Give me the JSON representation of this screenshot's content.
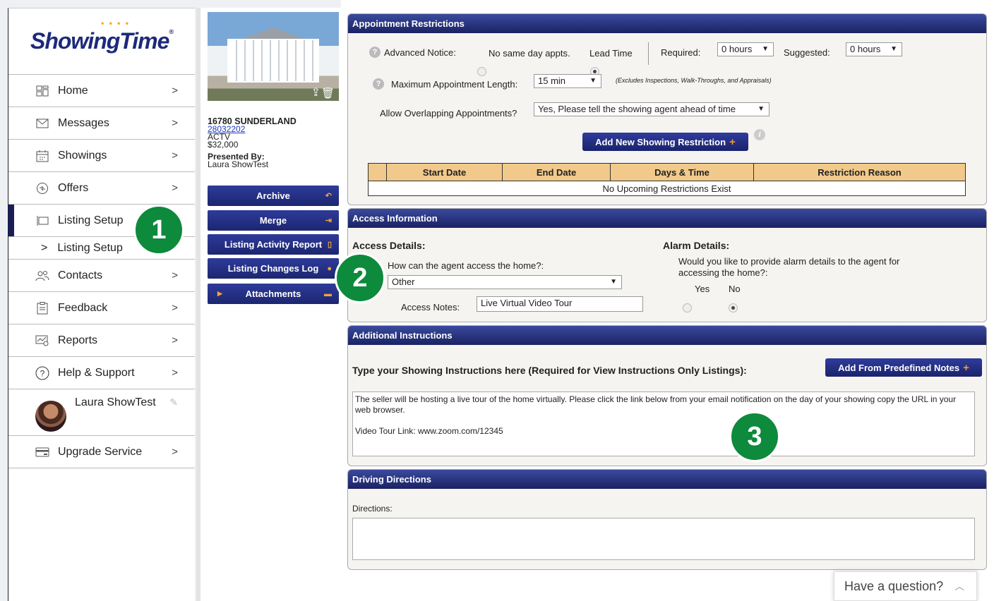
{
  "sidebar": {
    "logo": "ShowingTime",
    "items": [
      {
        "label": "Home",
        "icon": "home-grid-icon",
        "arrow": ">"
      },
      {
        "label": "Messages",
        "icon": "envelope-icon",
        "arrow": ">"
      },
      {
        "label": "Showings",
        "icon": "calendar-icon",
        "arrow": ">"
      },
      {
        "label": "Offers",
        "icon": "offer-icon",
        "arrow": ">"
      },
      {
        "label": "Listing Setup",
        "icon": "flag-icon",
        "arrow": ""
      },
      {
        "label": "Contacts",
        "icon": "contacts-icon",
        "arrow": ">"
      },
      {
        "label": "Feedback",
        "icon": "clipboard-icon",
        "arrow": ">"
      },
      {
        "label": "Reports",
        "icon": "reports-icon",
        "arrow": ">"
      },
      {
        "label": "Help & Support",
        "icon": "help-circle-icon",
        "arrow": ">"
      }
    ],
    "sub_item": {
      "prefix": ">",
      "label": "Listing Setup"
    },
    "user": {
      "name": "Laura ShowTest"
    },
    "upgrade": {
      "label": "Upgrade Service",
      "arrow": ">"
    }
  },
  "listing": {
    "address": "16780 SUNDERLAND",
    "mls": "28032202",
    "status": "ACTV",
    "price": "$32,000",
    "presented_by_label": "Presented By:",
    "presented_by": "Laura ShowTest",
    "buttons": [
      "Archive",
      "Merge",
      "Listing Activity Report",
      "Listing Changes Log",
      "Attachments"
    ]
  },
  "appointment": {
    "title": "Appointment Restrictions",
    "advanced_notice": "Advanced Notice:",
    "no_same_day": "No same day appts.",
    "lead_time": "Lead Time",
    "required_label": "Required:",
    "required_value": "0 hours",
    "suggested_label": "Suggested:",
    "suggested_value": "0 hours",
    "max_length_label": "Maximum Appointment Length:",
    "max_length_value": "15 min",
    "max_length_note": "(Excludes Inspections, Walk-Throughs, and Appraisals)",
    "overlap_label": "Allow Overlapping Appointments?",
    "overlap_value": "Yes, Please tell the showing agent ahead of time",
    "add_button": "Add New Showing Restriction",
    "table_headers": [
      "",
      "Start Date",
      "End Date",
      "Days & Time",
      "Restriction Reason"
    ],
    "empty_message": "No Upcoming Restrictions Exist"
  },
  "access": {
    "title": "Access Information",
    "details_heading": "Access Details:",
    "question": "How can the agent access the home?:",
    "method": "Other",
    "notes_label": "Access Notes:",
    "notes_value": "Live Virtual Video Tour",
    "alarm_heading": "Alarm Details:",
    "alarm_question": "Would you like to provide alarm details to the agent for accessing the home?:",
    "yes": "Yes",
    "no": "No"
  },
  "instructions": {
    "title": "Additional Instructions",
    "prompt": "Type your Showing Instructions here (Required for View Instructions Only Listings):",
    "add_notes_button": "Add From Predefined Notes",
    "text_line1": "The seller will be hosting a live tour of the home virtually. Please click the link below from your email notification on the day of your showing copy the URL in your web browser.",
    "text_line2": "Video Tour Link: www.zoom.com/12345"
  },
  "directions": {
    "title": "Driving Directions",
    "label": "Directions:"
  },
  "badges": [
    "1",
    "2",
    "3"
  ],
  "chat": {
    "label": "Have a question?"
  },
  "colors": {
    "navy": "#1b2262",
    "badge_green": "#0d8a3c",
    "table_header": "#f1c98a",
    "accent_orange": "#f39c2a"
  }
}
